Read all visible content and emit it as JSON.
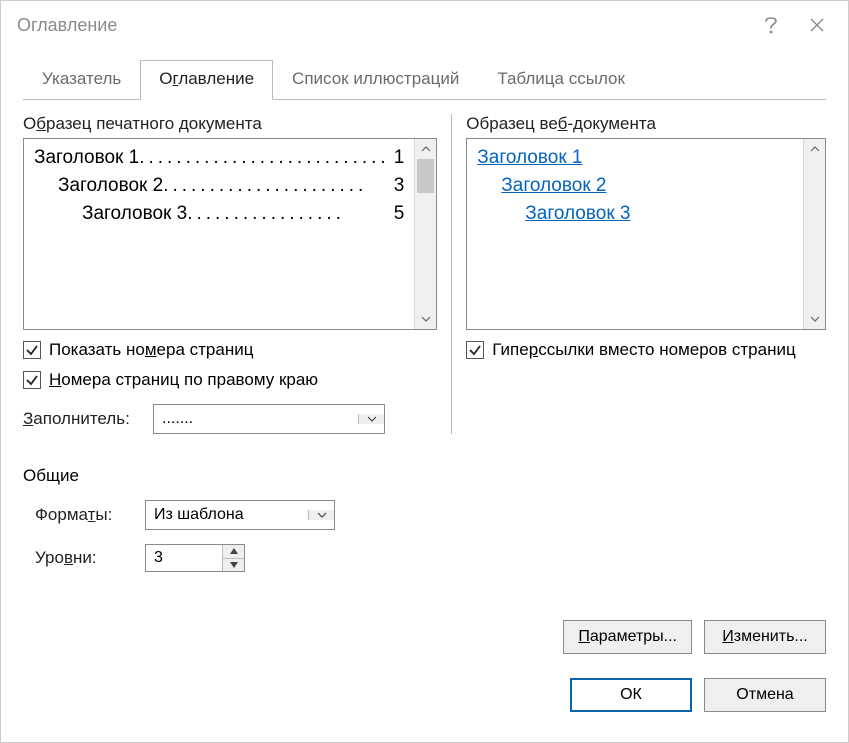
{
  "title": "Оглавление",
  "tabs": {
    "index": "Указатель",
    "toc": "Оглавление",
    "figures": "Список иллюстраций",
    "refs": "Таблица ссылок"
  },
  "print_preview": {
    "label_pre": "О",
    "label_u": "б",
    "label_post": "разец печатного документа",
    "items": [
      {
        "name": "Заголовок 1",
        "page": "1",
        "indent": "lvl1"
      },
      {
        "name": "Заголовок 2",
        "page": "3",
        "indent": "lvl2"
      },
      {
        "name": "Заголовок 3",
        "page": "5",
        "indent": "lvl3"
      }
    ]
  },
  "web_preview": {
    "label_pre": "Образец ве",
    "label_u": "б",
    "label_post": "-документа",
    "items": [
      {
        "name": "Заголовок 1",
        "indent": "wlvl1"
      },
      {
        "name": "Заголовок 2",
        "indent": "wlvl2"
      },
      {
        "name": "Заголовок 3",
        "indent": "wlvl3"
      }
    ]
  },
  "checks": {
    "show_pages_pre": "Показать но",
    "show_pages_u": "м",
    "show_pages_post": "ера страниц",
    "right_align_pre": "",
    "right_align_u": "Н",
    "right_align_post": "омера страниц по правому краю",
    "hyperlinks_pre": "Гипе",
    "hyperlinks_u": "р",
    "hyperlinks_post": "ссылки вместо номеров страниц"
  },
  "leader": {
    "label_pre": "",
    "label_u": "З",
    "label_post": "аполнитель:",
    "value": "......."
  },
  "general": {
    "label": "Общие",
    "formats_label_pre": "Форма",
    "formats_label_u": "т",
    "formats_label_post": "ы:",
    "formats_value": "Из шаблона",
    "levels_label_pre": "Уро",
    "levels_label_u": "в",
    "levels_label_post": "ни:",
    "levels_value": "3"
  },
  "buttons": {
    "options_pre": "",
    "options_u": "П",
    "options_post": "араметры...",
    "modify_pre": "",
    "modify_u": "И",
    "modify_post": "зменить...",
    "ok": "ОК",
    "cancel": "Отмена"
  }
}
